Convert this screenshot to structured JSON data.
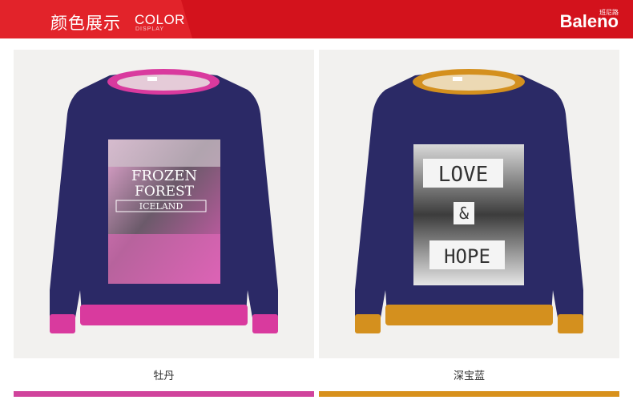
{
  "header": {
    "title_cn": "颜色展示",
    "title_en": "COLOR",
    "subtitle_en": "DISPLAY",
    "brand": "Baleno",
    "brand_cn": "班尼路",
    "background": "#d3121c"
  },
  "products": [
    {
      "color_name": "牡丹",
      "swatch": "#d0439c",
      "trim": "#d93a9e",
      "body": "#2b2966",
      "print_lines": [
        "FROZEN",
        "FOREST",
        "ICELAND"
      ]
    },
    {
      "color_name": "深宝蓝",
      "swatch": "#d8911c",
      "trim": "#d4901e",
      "body": "#2b2a66",
      "print_lines": [
        "LOVE",
        "&",
        "HOPE"
      ]
    }
  ]
}
